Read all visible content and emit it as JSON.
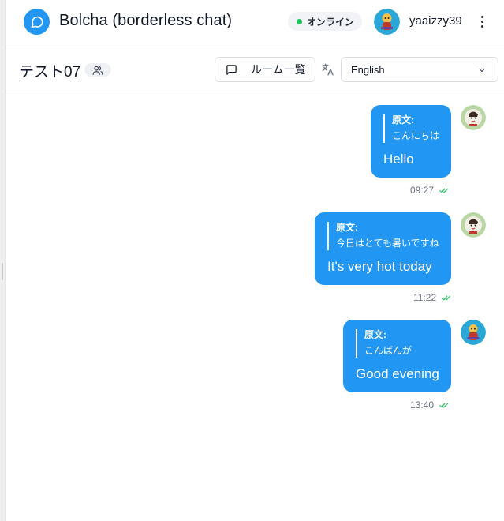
{
  "header": {
    "app_title": "Bolcha (borderless chat)",
    "status_label": "オンライン",
    "username": "yaaizzy39"
  },
  "room": {
    "name": "テスト07",
    "room_list_label": "ルーム一覧",
    "language_selected": "English"
  },
  "messages": [
    {
      "original_label": "原文:",
      "original_text": "こんにちは",
      "translated_text": "Hello",
      "time": "09:27"
    },
    {
      "original_label": "原文:",
      "original_text": "今日はとても暑いですね",
      "translated_text": "It's very hot today",
      "time": "11:22"
    },
    {
      "original_label": "原文:",
      "original_text": "こんばんが",
      "translated_text": "Good evening",
      "time": "13:40"
    }
  ],
  "colors": {
    "accent": "#2196f3",
    "online": "#22c55e",
    "read_check": "#22c55e"
  },
  "icons": {
    "logo": "chat-bubble-icon",
    "menu": "kebab-menu-icon",
    "members": "users-icon",
    "room_list": "message-square-icon",
    "translate": "translate-icon",
    "dropdown": "chevron-down-icon",
    "read": "double-check-icon"
  }
}
